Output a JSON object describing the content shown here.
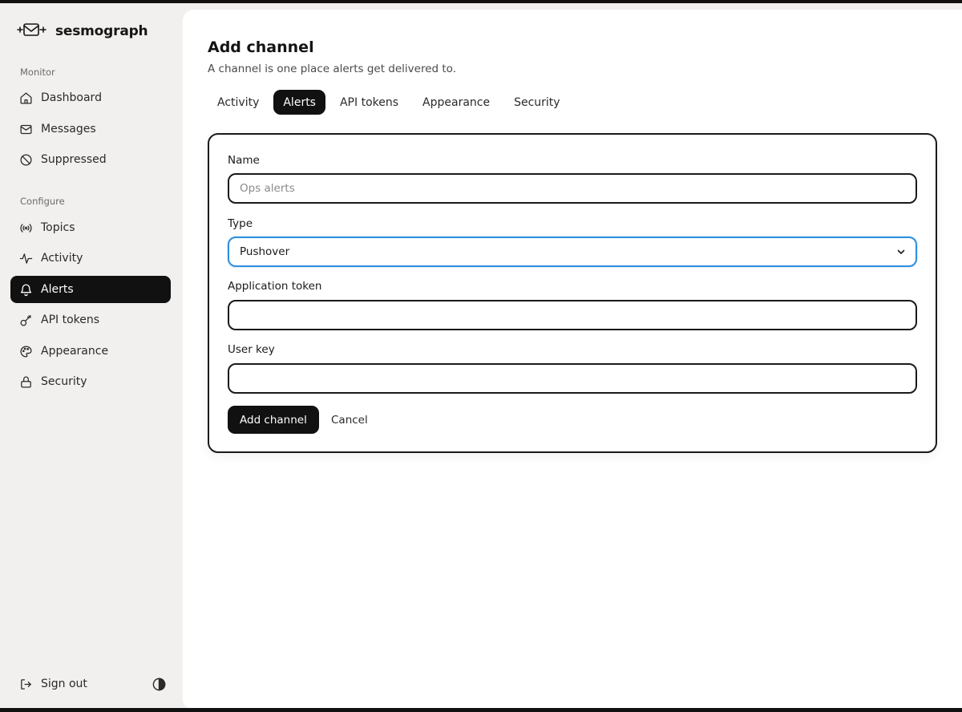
{
  "app": {
    "brand": "sesmograph",
    "logo_icon": "envelope-signal-icon"
  },
  "sidebar": {
    "sections": [
      {
        "label": "Monitor",
        "items": [
          {
            "label": "Dashboard",
            "icon": "home-icon"
          },
          {
            "label": "Messages",
            "icon": "mail-icon"
          },
          {
            "label": "Suppressed",
            "icon": "ban-icon"
          }
        ]
      },
      {
        "label": "Configure",
        "items": [
          {
            "label": "Topics",
            "icon": "broadcast-icon"
          },
          {
            "label": "Activity",
            "icon": "activity-icon"
          },
          {
            "label": "Alerts",
            "icon": "bell-icon",
            "active": true
          },
          {
            "label": "API tokens",
            "icon": "key-icon"
          },
          {
            "label": "Appearance",
            "icon": "palette-icon"
          },
          {
            "label": "Security",
            "icon": "lock-icon"
          }
        ]
      }
    ],
    "footer": {
      "signout_label": "Sign out",
      "theme_icon": "contrast-icon"
    }
  },
  "main": {
    "title": "Add channel",
    "subtitle": "A channel is one place alerts get delivered to.",
    "tabs": [
      {
        "label": "Activity"
      },
      {
        "label": "Alerts",
        "active": true
      },
      {
        "label": "API tokens"
      },
      {
        "label": "Appearance"
      },
      {
        "label": "Security"
      }
    ],
    "form": {
      "name_label": "Name",
      "name_placeholder": "Ops alerts",
      "name_value": "",
      "type_label": "Type",
      "type_value": "Pushover",
      "app_token_label": "Application token",
      "app_token_value": "",
      "user_key_label": "User key",
      "user_key_value": "",
      "submit_label": "Add channel",
      "cancel_label": "Cancel"
    }
  },
  "colors": {
    "accent": "#111111",
    "focus": "#2e8fe0",
    "sidebar_bg": "#f1f0ee"
  }
}
